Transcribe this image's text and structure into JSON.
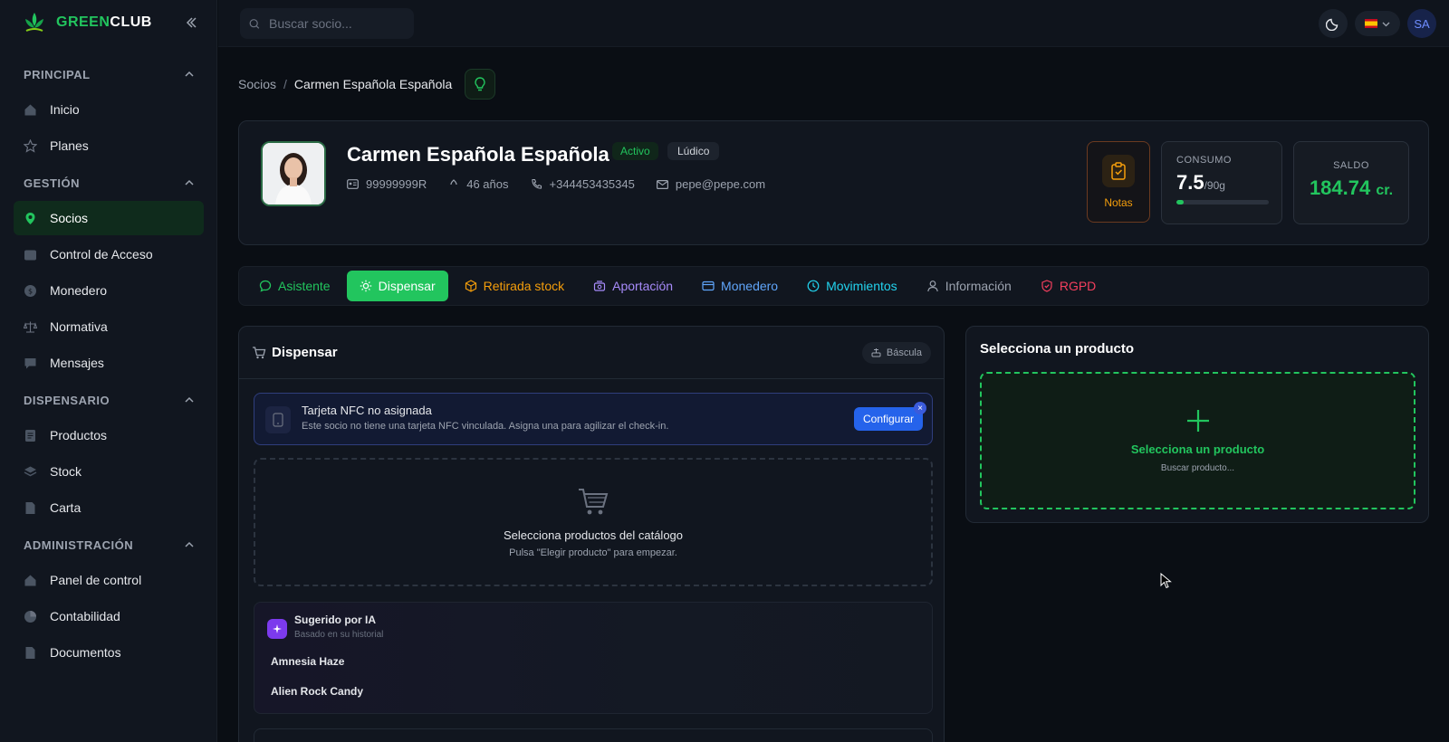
{
  "brand": {
    "name_green": "GREEN",
    "name_white": "CLUB"
  },
  "search": {
    "placeholder": "Buscar socio..."
  },
  "topbar": {
    "avatar_initials": "SA"
  },
  "sidebar": {
    "sections": [
      {
        "title": "PRINCIPAL",
        "items": [
          {
            "label": "Inicio"
          },
          {
            "label": "Planes"
          }
        ]
      },
      {
        "title": "GESTIÓN",
        "items": [
          {
            "label": "Socios"
          },
          {
            "label": "Control de Acceso"
          },
          {
            "label": "Monedero"
          },
          {
            "label": "Normativa"
          },
          {
            "label": "Mensajes"
          }
        ]
      },
      {
        "title": "DISPENSARIO",
        "items": [
          {
            "label": "Productos"
          },
          {
            "label": "Stock"
          },
          {
            "label": "Carta"
          }
        ]
      },
      {
        "title": "ADMINISTRACIÓN",
        "items": [
          {
            "label": "Panel de control"
          },
          {
            "label": "Contabilidad"
          },
          {
            "label": "Documentos"
          }
        ]
      }
    ],
    "active": "Socios"
  },
  "breadcrumb": {
    "parent": "Socios",
    "separator": "/",
    "current": "Carmen Española Española"
  },
  "profile": {
    "name": "Carmen Española Española",
    "status": "Activo",
    "type": "Lúdico",
    "id_number": "99999999R",
    "age": "46 años",
    "phone": "+344453435345",
    "email": "pepe@pepe.com",
    "notes_label": "Notas",
    "consumo_label": "CONSUMO",
    "consumo_value": "7.5",
    "consumo_max": "/90g",
    "consumo_fraction": 0.083,
    "saldo_label": "SALDO",
    "saldo_value": "184.74",
    "saldo_unit": "cr."
  },
  "tabs": [
    {
      "label": "Asistente",
      "color": "#22c55e",
      "icon": "chat-icon"
    },
    {
      "label": "Dispensar",
      "color": "#ffffff",
      "icon": "sun-icon",
      "active": true
    },
    {
      "label": "Retirada stock",
      "color": "#f59e0b",
      "icon": "box-icon"
    },
    {
      "label": "Aportación",
      "color": "#a78bfa",
      "icon": "gift-icon"
    },
    {
      "label": "Monedero",
      "color": "#60a5fa",
      "icon": "card-icon"
    },
    {
      "label": "Movimientos",
      "color": "#22d3ee",
      "icon": "clock-icon"
    },
    {
      "label": "Información",
      "color": "#9ca3af",
      "icon": "user-icon"
    },
    {
      "label": "RGPD",
      "color": "#f43f5e",
      "icon": "shield-icon"
    }
  ],
  "dispensar": {
    "title": "Dispensar",
    "bascula_label": "Báscula",
    "nfc_title": "Tarjeta NFC no asignada",
    "nfc_desc": "Este socio no tiene una tarjeta NFC vinculada. Asigna una para agilizar el check-in.",
    "nfc_button": "Configurar",
    "nfc_close": "×",
    "empty_title": "Selecciona productos del catálogo",
    "empty_sub": "Pulsa \"Elegir producto\" para empezar.",
    "ai_title": "Sugerido por IA",
    "ai_sub": "Basado en su historial",
    "ai_items": [
      "Amnesia Haze",
      "Alien Rock Candy"
    ]
  },
  "product_select": {
    "title": "Selecciona un producto",
    "box_title": "Selecciona un producto",
    "box_sub": "Buscar producto..."
  }
}
